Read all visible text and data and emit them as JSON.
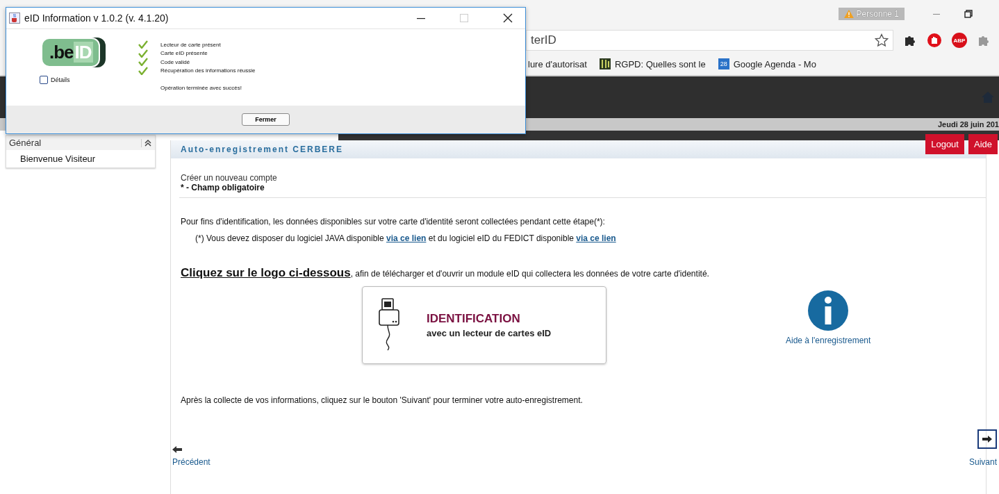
{
  "browser": {
    "profile": "Personne 1",
    "address": "terID",
    "adblock_label": "ABP",
    "bookmarks": [
      {
        "label": "lure d'autorisat",
        "kind": "plain"
      },
      {
        "label": "RGPD: Quelles sont le",
        "kind": "book"
      },
      {
        "label": "Google Agenda - Mo",
        "kind": "calendar",
        "badge": "28"
      }
    ]
  },
  "header": {
    "date": "Jeudi 28 juin 201"
  },
  "top_buttons": [
    "Logout",
    "Aide"
  ],
  "sidebar": {
    "title": "Général",
    "expanded": true,
    "items": [
      "Bienvenue Visiteur"
    ]
  },
  "panel": {
    "title": "Auto-enregistrement CERBERE",
    "subtitle": "Créer un nouveau compte",
    "required_note": "* - Champ obligatoire",
    "intro": "Pour fins d'identification, les données disponibles sur votre carte d'identité seront collectées pendant cette étape(*):",
    "note": [
      {
        "kind": "text",
        "text": "(*) Vous devez disposer du logiciel JAVA disponible "
      },
      {
        "kind": "link",
        "text": "via ce lien"
      },
      {
        "kind": "text",
        "text": " et du logiciel eID du FEDICT disponible "
      },
      {
        "kind": "link",
        "text": "via ce lien"
      }
    ],
    "instruction": [
      {
        "kind": "link",
        "text": "Cliquez sur le logo ci-dessous"
      },
      {
        "kind": "text",
        "text": ", afin de télécharger et d'ouvrir un module eID qui collectera les données de votre carte d'identité."
      }
    ],
    "id_card": {
      "title": "IDENTIFICATION",
      "subtitle": "avec un lecteur de cartes eID"
    },
    "help_link": "Aide à l'enregistrement",
    "after_note": "Après la collecte de vos informations, cliquez sur le bouton 'Suivant' pour terminer votre auto-enregistrement.",
    "previous": "Précédent",
    "next": "Suivant"
  },
  "dialog": {
    "title": "eID Information v 1.0.2 (v. 4.1.20)",
    "logo_prefix": ".be",
    "logo_suffix": "ID",
    "steps": [
      {
        "label": "Lecteur de carte présent",
        "done": true
      },
      {
        "label": "Carte eID présente",
        "done": true
      },
      {
        "label": "Code validé",
        "done": true
      },
      {
        "label": "Récupération des informations réussie",
        "done": true
      }
    ],
    "details": {
      "label": "Détails",
      "checked": false
    },
    "message": "Opération terminée avec succès!",
    "button": "Fermer"
  }
}
